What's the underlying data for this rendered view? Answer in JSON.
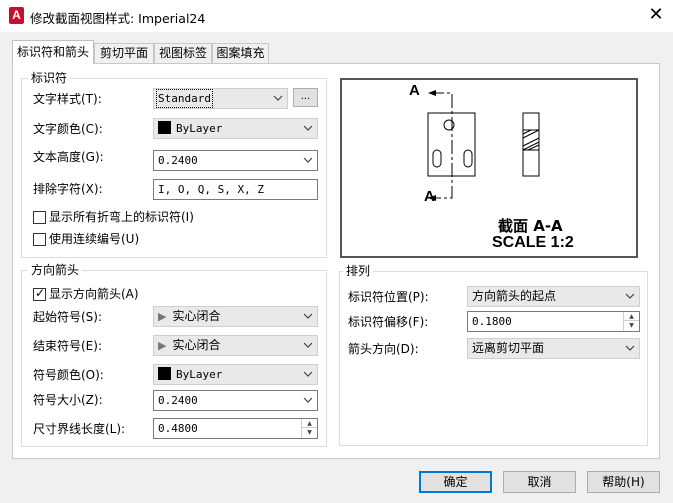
{
  "window": {
    "title": "修改截面视图样式: Imperial24",
    "close_glyph": "✕",
    "app_icon_letter": "A"
  },
  "tabs": [
    {
      "label": "标识符和箭头",
      "active": true
    },
    {
      "label": "剪切平面",
      "active": false
    },
    {
      "label": "视图标签",
      "active": false
    },
    {
      "label": "图案填充",
      "active": false
    }
  ],
  "identifier": {
    "group_title": "标识符",
    "text_style_label": "文字样式(T):",
    "text_style_value": "Standard",
    "text_style_more": "...",
    "text_color_label": "文字颜色(C):",
    "text_color_value": "ByLayer",
    "text_height_label": "文本高度(G):",
    "text_height_value": "0.2400",
    "exclude_label": "排除字符(X):",
    "exclude_value": "I, O, Q, S, X, Z",
    "show_all_bends_label": "显示所有折弯上的标识符(I)",
    "show_all_bends_checked": false,
    "continuous_label": "使用连续编号(U)",
    "continuous_checked": false
  },
  "arrow": {
    "group_title": "方向箭头",
    "show_label": "显示方向箭头(A)",
    "show_checked": true,
    "start_label": "起始符号(S):",
    "start_value": "实心闭合",
    "end_label": "结束符号(E):",
    "end_value": "实心闭合",
    "color_label": "符号颜色(O):",
    "color_value": "ByLayer",
    "size_label": "符号大小(Z):",
    "size_value": "0.2400",
    "ext_label": "尺寸界线长度(L):",
    "ext_value": "0.4800"
  },
  "preview": {
    "label_a_top": "A",
    "label_a_bottom": "A",
    "section_title": "截面 A-A",
    "scale_text": "SCALE 1:2"
  },
  "arrangement": {
    "group_title": "排列",
    "position_label": "标识符位置(P):",
    "position_value": "方向箭头的起点",
    "offset_label": "标识符偏移(F):",
    "offset_value": "0.1800",
    "direction_label": "箭头方向(D):",
    "direction_value": "远离剪切平面"
  },
  "buttons": {
    "ok": "确定",
    "cancel": "取消",
    "help": "帮助(H)"
  },
  "colors": {
    "accent": "#0078d7",
    "app_icon": "#c8102e"
  }
}
